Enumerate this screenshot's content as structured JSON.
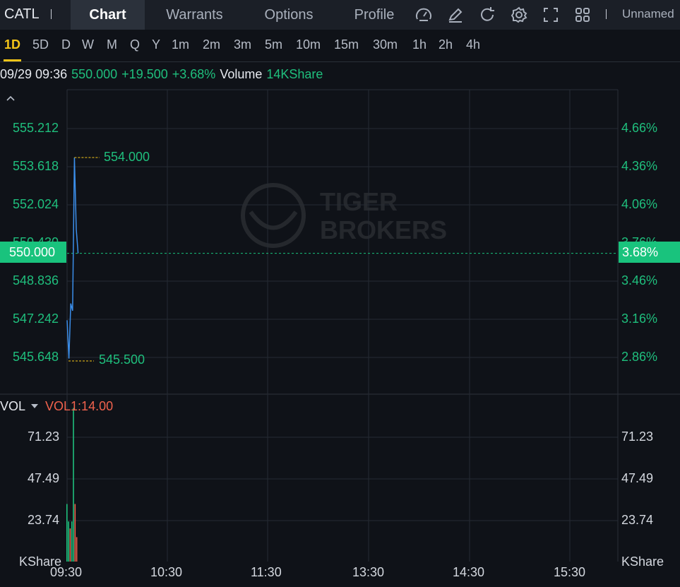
{
  "topbar": {
    "symbol": "CATL",
    "tabs": [
      "Chart",
      "Warrants",
      "Options",
      "Profile"
    ],
    "active_tab": "Chart",
    "icons": [
      "gauge-icon",
      "draw-icon",
      "refresh-icon",
      "settings-icon",
      "fullscreen-icon",
      "layout-grid-icon"
    ],
    "layout_name": "Unnamed"
  },
  "intervals": {
    "items": [
      "1D",
      "5D",
      "D",
      "W",
      "M",
      "Q",
      "Y",
      "1m",
      "2m",
      "3m",
      "5m",
      "10m",
      "15m",
      "30m",
      "1h",
      "2h",
      "4h"
    ],
    "active": "1D"
  },
  "info": {
    "datetime": "09/29 09:36",
    "price": "550.000",
    "change": "+19.500",
    "change_pct": "+3.68%",
    "volume_label": "Volume",
    "volume_value": "14KShare"
  },
  "price_axis": {
    "left_labels": [
      "555.212",
      "553.618",
      "552.024",
      "550.430",
      "548.836",
      "547.242",
      "545.648"
    ],
    "right_labels": [
      "4.66%",
      "4.36%",
      "4.06%",
      "3.76%",
      "3.46%",
      "3.16%",
      "2.86%"
    ],
    "current_price": "550.000",
    "current_pct": "3.68%",
    "high_label": "554.000",
    "low_label": "545.500"
  },
  "volume_pane": {
    "name": "VOL",
    "indicator": "VOL1:14.00",
    "axis_labels": [
      "71.23",
      "47.49",
      "23.74"
    ],
    "unit": "KShare"
  },
  "time_axis": [
    "09:30",
    "10:30",
    "11:30",
    "13:30",
    "14:30",
    "15:30"
  ],
  "watermark": {
    "line1": "TIGER",
    "line2": "BROKERS"
  },
  "colors": {
    "up": "#1fbf7d",
    "down": "#f0624d",
    "line": "#3b8eea",
    "accent": "#f5c518",
    "current": "#19c37d"
  },
  "chart_data": [
    {
      "type": "line",
      "title": "",
      "x": [
        "09:30",
        "09:31",
        "09:32",
        "09:33",
        "09:34",
        "09:35",
        "09:36"
      ],
      "series": [
        {
          "values": [
            547.2,
            545.6,
            547.9,
            547.6,
            554.0,
            551.0,
            550.0
          ]
        }
      ],
      "ylim": [
        545.0,
        556.2
      ],
      "high": 554.0,
      "low": 545.5,
      "current": 550.0,
      "grid": true
    },
    {
      "type": "bar",
      "title": "",
      "x": [
        "09:30",
        "09:31",
        "09:32",
        "09:33",
        "09:34",
        "09:35",
        "09:36"
      ],
      "series": [
        {
          "name": "VOL",
          "values": [
            33,
            23,
            19,
            23,
            88,
            33,
            14
          ]
        }
      ],
      "colors": [
        "up",
        "up",
        "down",
        "up",
        "up",
        "down",
        "down"
      ],
      "ylim": [
        0,
        90
      ],
      "grid": true
    }
  ]
}
